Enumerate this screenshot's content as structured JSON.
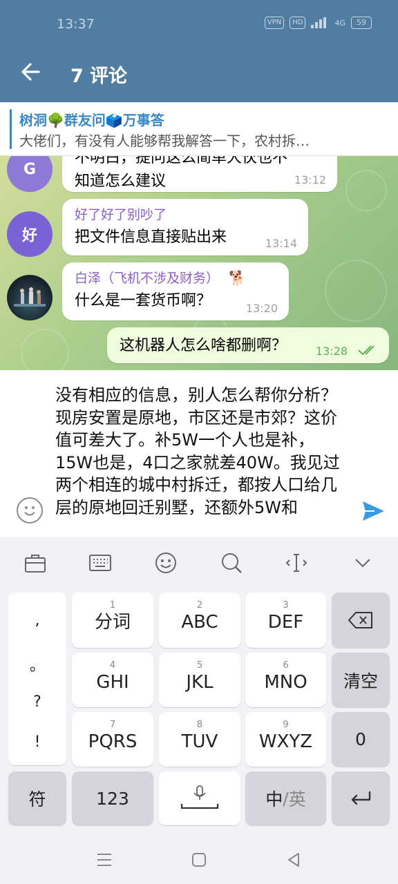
{
  "status": {
    "time": "13:37",
    "vpn": "VPN",
    "hd": "HD",
    "net": "4G",
    "battery": "59"
  },
  "header": {
    "title": "7 评论"
  },
  "pinned": {
    "title": "树洞🌳群友问🗳️万事答",
    "text": "大佬们，有没有人能够帮我解答一下，农村拆…"
  },
  "messages": [
    {
      "avatar_letter": "G",
      "text_top": "不明白，提问这么简单大伙也不",
      "text": "知道怎么建议",
      "time": "13:12"
    },
    {
      "avatar_letter": "好",
      "sender": "好了好了别吵了",
      "text": "把文件信息直接贴出来",
      "time": "13:14"
    },
    {
      "sender": "白泽（飞机不涉及财务）",
      "sender_emoji": "🐕",
      "text": "什么是一套货币啊？",
      "time": "13:20"
    },
    {
      "text": "这机器人怎么啥都删啊？",
      "time": "13:28"
    }
  ],
  "input": {
    "text": "没有相应的信息，别人怎么帮你分析？现房安置是原地，市区还是市郊？这价值可差大了。补5W一个人也是补，15W也是，4口之家就差40W。我见过两个相连的城中村拆迁，都按人口给几层的原地回迁别墅，还额外5W和"
  },
  "keyboard": {
    "punct": [
      ",",
      "。",
      "?",
      "!"
    ],
    "row1": [
      {
        "num": "1",
        "label": "分词"
      },
      {
        "num": "2",
        "label": "ABC"
      },
      {
        "num": "3",
        "label": "DEF"
      }
    ],
    "row2": [
      {
        "num": "4",
        "label": "GHI"
      },
      {
        "num": "5",
        "label": "JKL"
      },
      {
        "num": "6",
        "label": "MNO"
      }
    ],
    "row3": [
      {
        "num": "7",
        "label": "PQRS"
      },
      {
        "num": "8",
        "label": "TUV"
      },
      {
        "num": "9",
        "label": "WXYZ"
      }
    ],
    "clear": "清空",
    "zero": "0",
    "symbol": "符",
    "num123": "123",
    "lang_zh": "中",
    "lang_sep": "/",
    "lang_en": "英"
  },
  "colors": {
    "header": "#517da2",
    "accent": "#3a87c8",
    "sender": "#8b5fc7",
    "outgoing": "#effdde"
  }
}
